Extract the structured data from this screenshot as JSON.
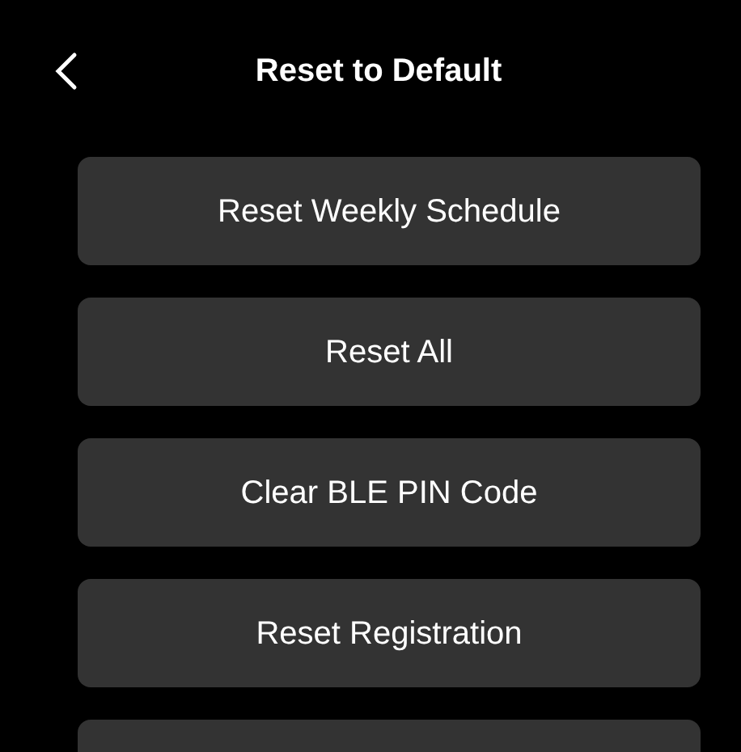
{
  "header": {
    "title": "Reset to Default"
  },
  "buttons": [
    {
      "label": "Reset Weekly Schedule"
    },
    {
      "label": "Reset All"
    },
    {
      "label": "Clear BLE PIN Code"
    },
    {
      "label": "Reset Registration"
    }
  ]
}
